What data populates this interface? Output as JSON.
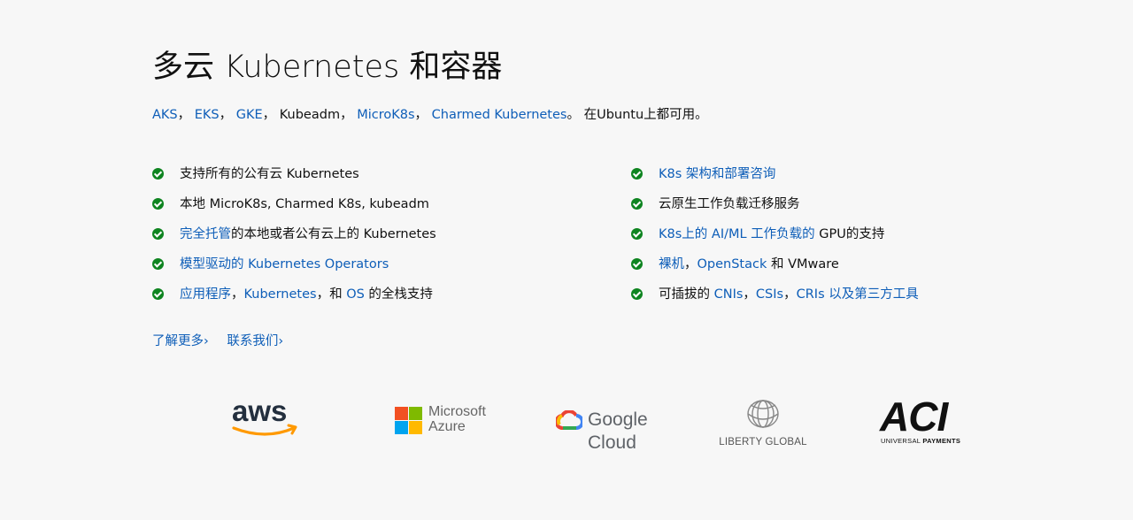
{
  "heading": "多云 Kubernetes 和容器",
  "intro": {
    "links": [
      "AKS",
      "EKS",
      "GKE"
    ],
    "sep1": "，",
    "kubeadm": "Kubeadm",
    "sep2": "，",
    "microk8s": "MicroK8s",
    "sep3": "，",
    "charmed": "Charmed Kubernetes",
    "tail": "。 在Ubuntu上都可用。"
  },
  "left_list": [
    {
      "text": "支持所有的公有云 Kubernetes"
    },
    {
      "text": "本地 MicroK8s, Charmed K8s, kubeadm"
    },
    {
      "link": "完全托管",
      "rest": "的本地或者公有云上的 Kubernetes"
    },
    {
      "link": "模型驱动的 Kubernetes Operators"
    },
    {
      "link1": "应用程序",
      "sep1": "，",
      "link2": "Kubernetes",
      "sep2": "，和 ",
      "link3": "OS",
      "rest": " 的全栈支持"
    }
  ],
  "right_list": [
    {
      "link": "K8s 架构和部署咨询"
    },
    {
      "text": "云原生工作负载迁移服务"
    },
    {
      "link": "K8s上的 AI/ML 工作负载的",
      "rest": " GPU的支持"
    },
    {
      "link1": "裸机",
      "sep1": "，",
      "link2": "OpenStack",
      "rest": " 和 VMware"
    },
    {
      "pre": "可插拔的 ",
      "link1": "CNIs",
      "sep1": "，",
      "link2": "CSIs",
      "sep2": "，",
      "link3": "CRIs 以及第三方工具"
    }
  ],
  "more_links": [
    "了解更多›",
    "联系我们›"
  ],
  "logos": {
    "aws": "aws",
    "microsoft": [
      "Microsoft",
      "Azure"
    ],
    "google": "Google Cloud",
    "liberty": "LIBERTY GLOBAL",
    "aci": [
      "ACI",
      "UNIVERSAL",
      "PAYMENTS"
    ]
  },
  "colors": {
    "link": "#0e5eb8",
    "check": "#0e8420",
    "background": "#f7f7f7"
  }
}
